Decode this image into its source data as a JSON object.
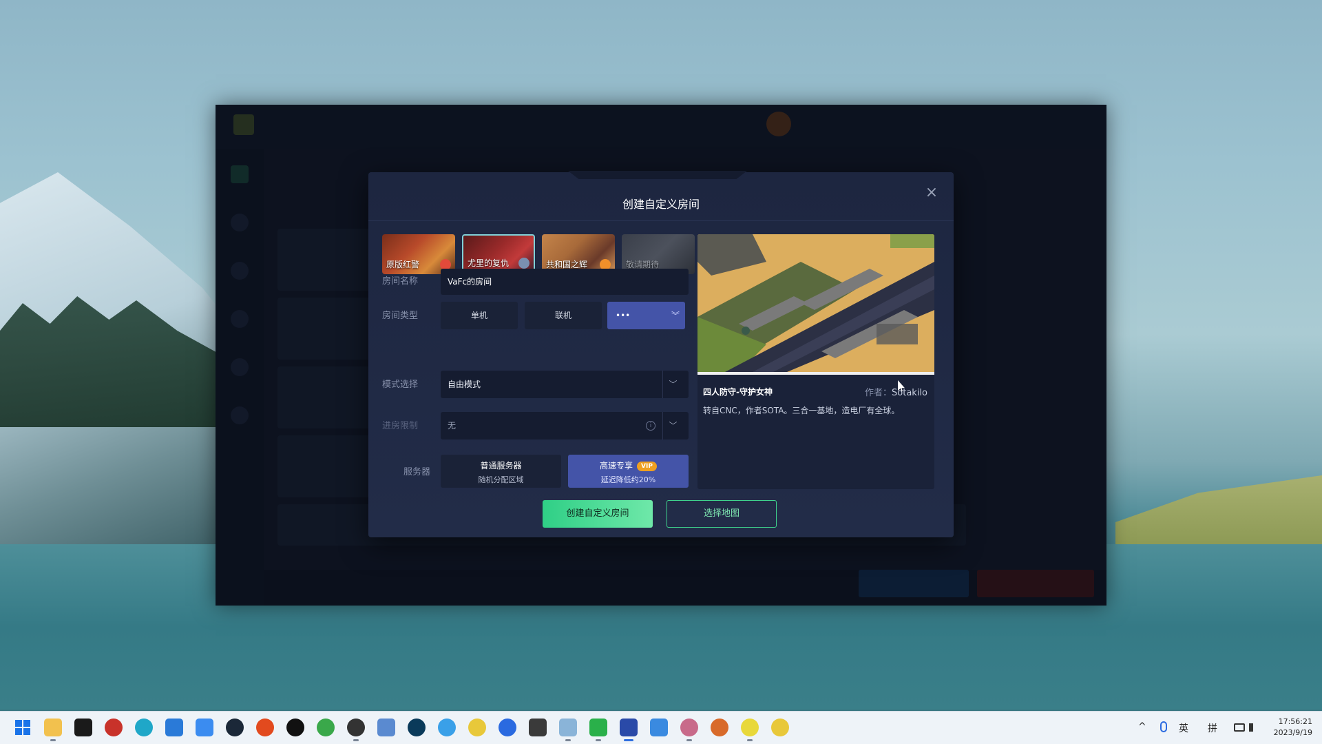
{
  "modal": {
    "title": "创建自定义房间",
    "close_label": "×",
    "game_tabs": [
      {
        "label": "原版红警"
      },
      {
        "label": "尤里的复仇"
      },
      {
        "label": "共和国之辉"
      },
      {
        "label": "敬请期待"
      }
    ],
    "room_name": {
      "label": "房间名称",
      "value": "VaFc的房间"
    },
    "room_type": {
      "label": "房间类型",
      "options": [
        "单机",
        "联机",
        "•••"
      ],
      "active_tail": "︾"
    },
    "mode": {
      "label": "模式选择",
      "value": "自由模式",
      "chevron": "﹀"
    },
    "entry_limit": {
      "label": "进房限制",
      "value": "无",
      "info": "i",
      "chevron": "﹀"
    },
    "server": {
      "label": "服务器",
      "normal": {
        "title": "普通服务器",
        "subtitle": "随机分配区域"
      },
      "fast": {
        "title": "高速专享",
        "badge": "VIP",
        "subtitle": "延迟降低约20%"
      }
    },
    "map": {
      "name": "四人防守-守护女神",
      "author_label": "作者：",
      "author": "Sotakilo",
      "description": "转自CNC，作者SOTA。三合一基地，造电厂有全球。"
    },
    "create_button": "创建自定义房间",
    "select_map_button": "选择地图"
  },
  "taskbar": {
    "tray": {
      "ime_lang": "英",
      "ime_mode": "拼",
      "chevron": "^"
    },
    "clock": {
      "time": "17:56:21",
      "date": "2023/9/19"
    }
  }
}
